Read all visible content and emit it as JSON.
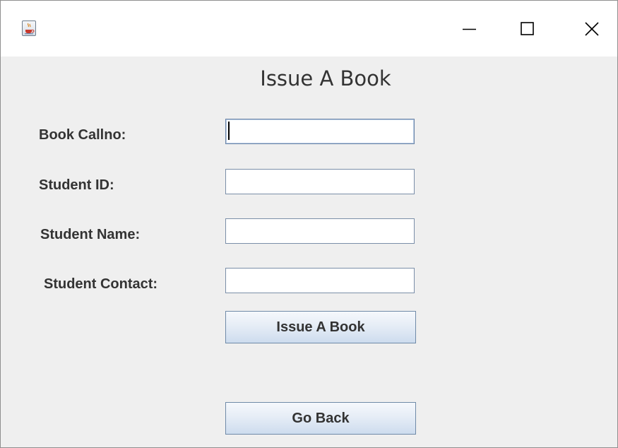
{
  "window": {
    "title": "",
    "icon": "java-cup-icon",
    "controls": {
      "minimize": "minimize-icon",
      "maximize": "maximize-icon",
      "close": "close-icon"
    }
  },
  "form": {
    "heading": "Issue A Book",
    "fields": [
      {
        "label": "Book Callno:",
        "value": "",
        "focused": true
      },
      {
        "label": "Student ID:",
        "value": ""
      },
      {
        "label": "Student Name:",
        "value": ""
      },
      {
        "label": "Student Contact:",
        "value": ""
      }
    ],
    "issue_button_label": "Issue A Book",
    "back_button_label": "Go Back"
  },
  "colors": {
    "background": "#efefef",
    "text": "#333333",
    "button_border": "#6f8aa8"
  }
}
